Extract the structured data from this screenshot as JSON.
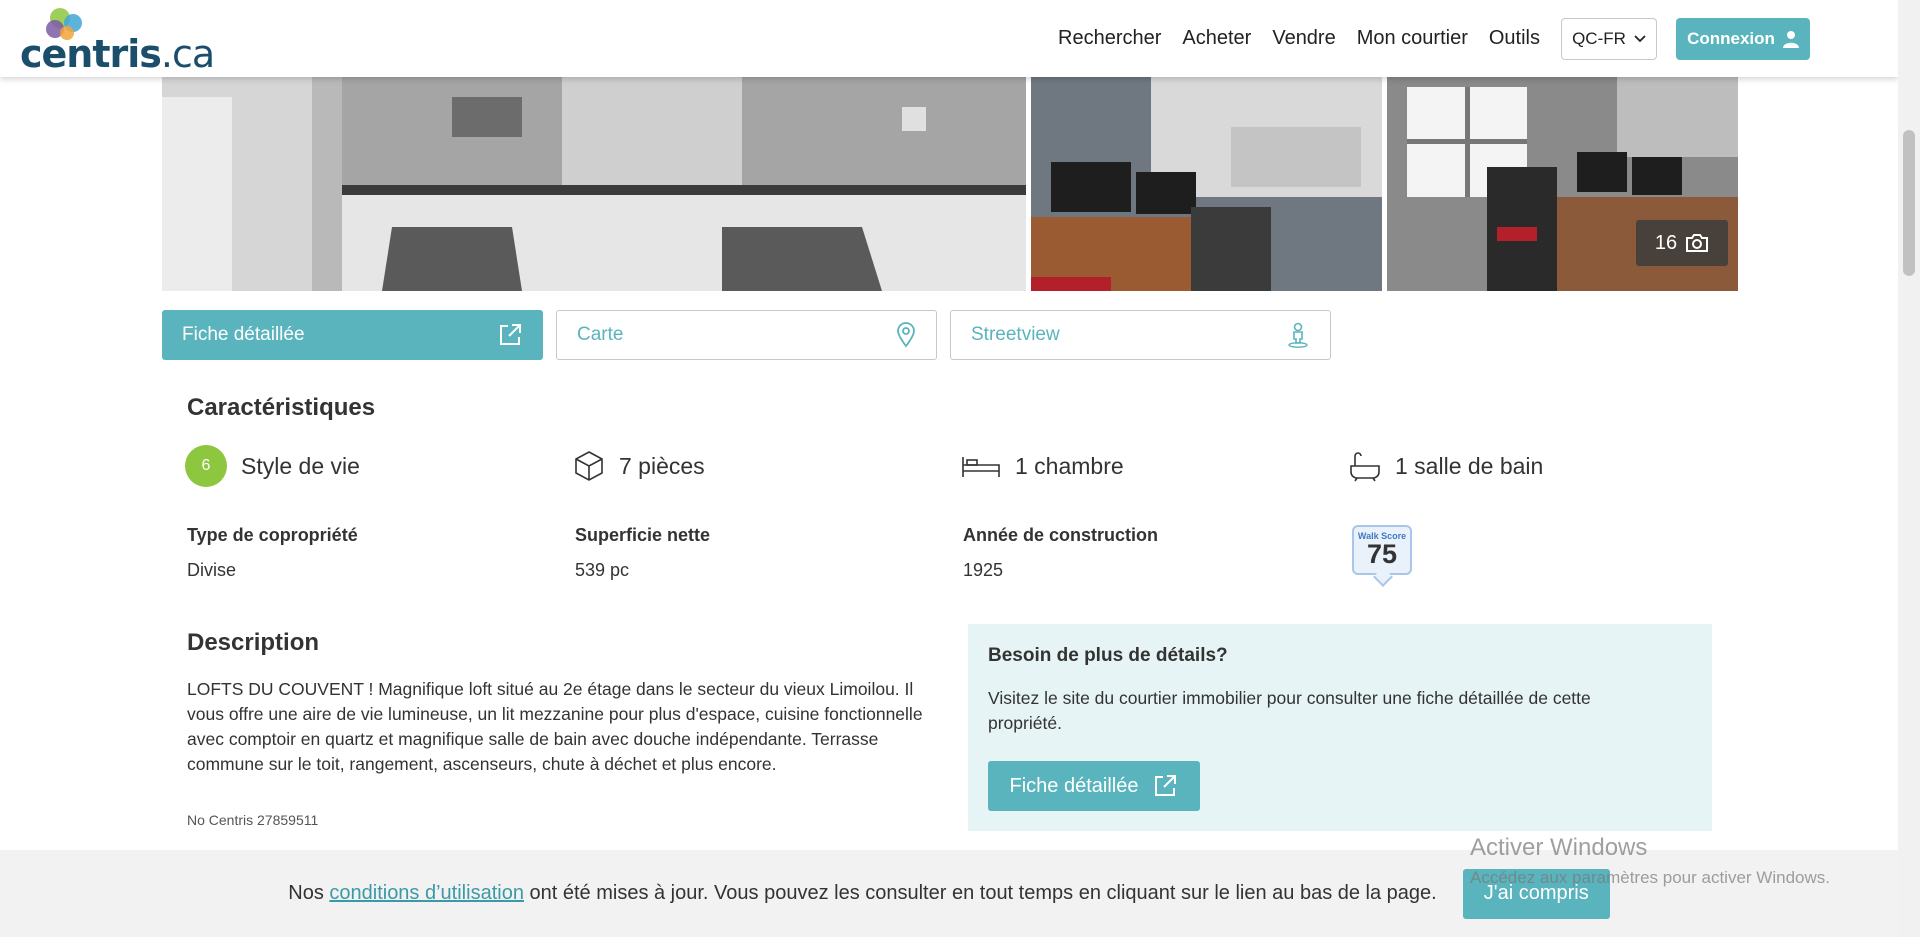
{
  "header": {
    "logo_text_main": "centris",
    "logo_text_suffix": ".ca",
    "nav": [
      "Rechercher",
      "Acheter",
      "Vendre",
      "Mon courtier",
      "Outils"
    ],
    "lang": "QC-FR",
    "login": "Connexion"
  },
  "gallery": {
    "photo_count": "16"
  },
  "tabs": {
    "detailed": "Fiche détaillée",
    "map": "Carte",
    "streetview": "Streetview"
  },
  "characteristics": {
    "title": "Caractéristiques",
    "lifestyle_score": "6",
    "lifestyle_label": "Style de vie",
    "rooms": "7 pièces",
    "bedrooms": "1 chambre",
    "bathrooms": "1 salle de bain",
    "ownership_label": "Type de copropriété",
    "ownership_value": "Divise",
    "area_label": "Superficie nette",
    "area_value": "539 pc",
    "year_label": "Année de construction",
    "year_value": "1925",
    "walk_label": "Walk Score",
    "walk_value": "75"
  },
  "description": {
    "title": "Description",
    "text": "LOFTS DU COUVENT ! Magnifique loft situé au 2e étage dans le secteur du vieux Limoilou. Il vous offre une aire de vie lumineuse, un lit mezzanine pour plus d'espace, cuisine fonctionnelle avec comptoir en quartz et magnifique salle de bain avec douche indépendante. Terrasse commune sur le toit, rangement, ascenseurs, chute à déchet et plus encore.",
    "centris_no": "No Centris 27859511"
  },
  "details_box": {
    "title": "Besoin de plus de détails?",
    "text": "Visitez le site du courtier immobilier pour consulter une fiche détaillée de cette propriété.",
    "button": "Fiche détaillée"
  },
  "cookie": {
    "prefix": "Nos ",
    "link": "conditions d’utilisation",
    "suffix": " ont été mises à jour. Vous pouvez les consulter en tout temps en cliquant sur le lien au bas de la page.",
    "button": "J'ai compris"
  },
  "watermark": {
    "title": "Activer Windows",
    "subtitle": "Accédez aux paramètres pour activer Windows."
  },
  "colors": {
    "accent": "#5ab4bd",
    "lifestyle": "#8dc63f",
    "logo": "#1a4e6b"
  }
}
